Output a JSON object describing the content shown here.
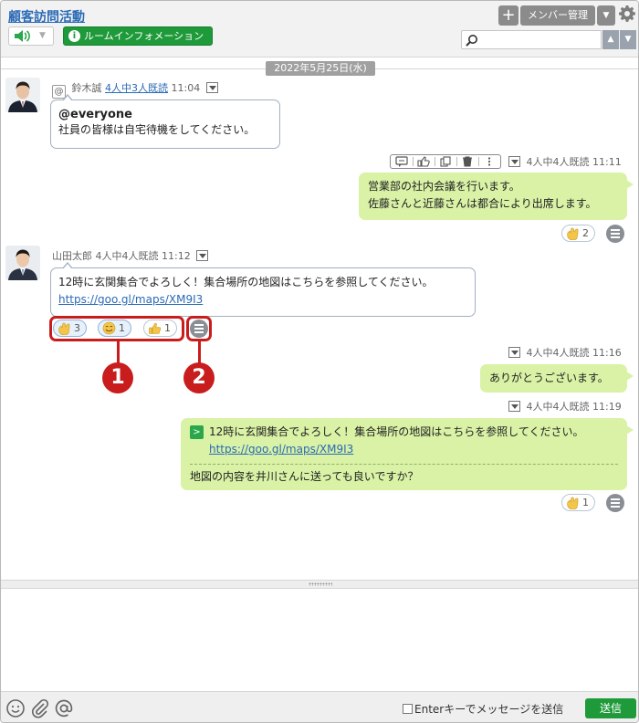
{
  "header": {
    "room_title": "顧客訪問活動",
    "room_info_label": "ルームインフォメーション",
    "member_label": "メンバー管理",
    "search_placeholder": ""
  },
  "date_separator": "2022年5月25日(水)",
  "messages": [
    {
      "sender": "鈴木誠",
      "read_status": "4人中3人既読",
      "time": "11:04",
      "mention": "@everyone",
      "text": "社員の皆様は自宅待機をしてください。"
    },
    {
      "read_status": "4人中4人既読",
      "time": "11:11",
      "line1": "営業部の社内会議を行います。",
      "line2": "佐藤さんと近藤さんは都合により出席します。",
      "reactions": [
        {
          "emoji": "ok-hand",
          "count": "2"
        }
      ]
    },
    {
      "sender": "山田太郎",
      "read_status": "4人中4人既読",
      "time": "11:12",
      "line1": "12時に玄関集合でよろしく！集合場所の地図はこちらを参照してください。",
      "link": "https://goo.gl/maps/XM9I3",
      "reactions": [
        {
          "emoji": "ok-hand",
          "count": "3"
        },
        {
          "emoji": "smile",
          "count": "1"
        },
        {
          "emoji": "thumbs-up",
          "count": "1"
        }
      ]
    },
    {
      "read_status": "4人中4人既読",
      "time": "11:16",
      "text": "ありがとうございます。"
    },
    {
      "read_status": "4人中4人既読",
      "time": "11:19",
      "quote_line1": "12時に玄関集合でよろしく！集合場所の地図はこちらを参照してください。",
      "quote_link": "https://goo.gl/maps/XM9I3",
      "text": "地図の内容を井川さんに送っても良いですか？",
      "reactions": [
        {
          "emoji": "ok-hand",
          "count": "1"
        }
      ]
    }
  ],
  "annotations": {
    "badge1": "1",
    "badge2": "2"
  },
  "footer": {
    "enter_send_label": "Enterキーでメッセージを送信",
    "send_label": "送信"
  },
  "colors": {
    "accent_green": "#1f9a3a",
    "bubble_green": "#d9f2a6",
    "link_blue": "#2a6ab6",
    "highlight_red": "#c91d1d"
  }
}
